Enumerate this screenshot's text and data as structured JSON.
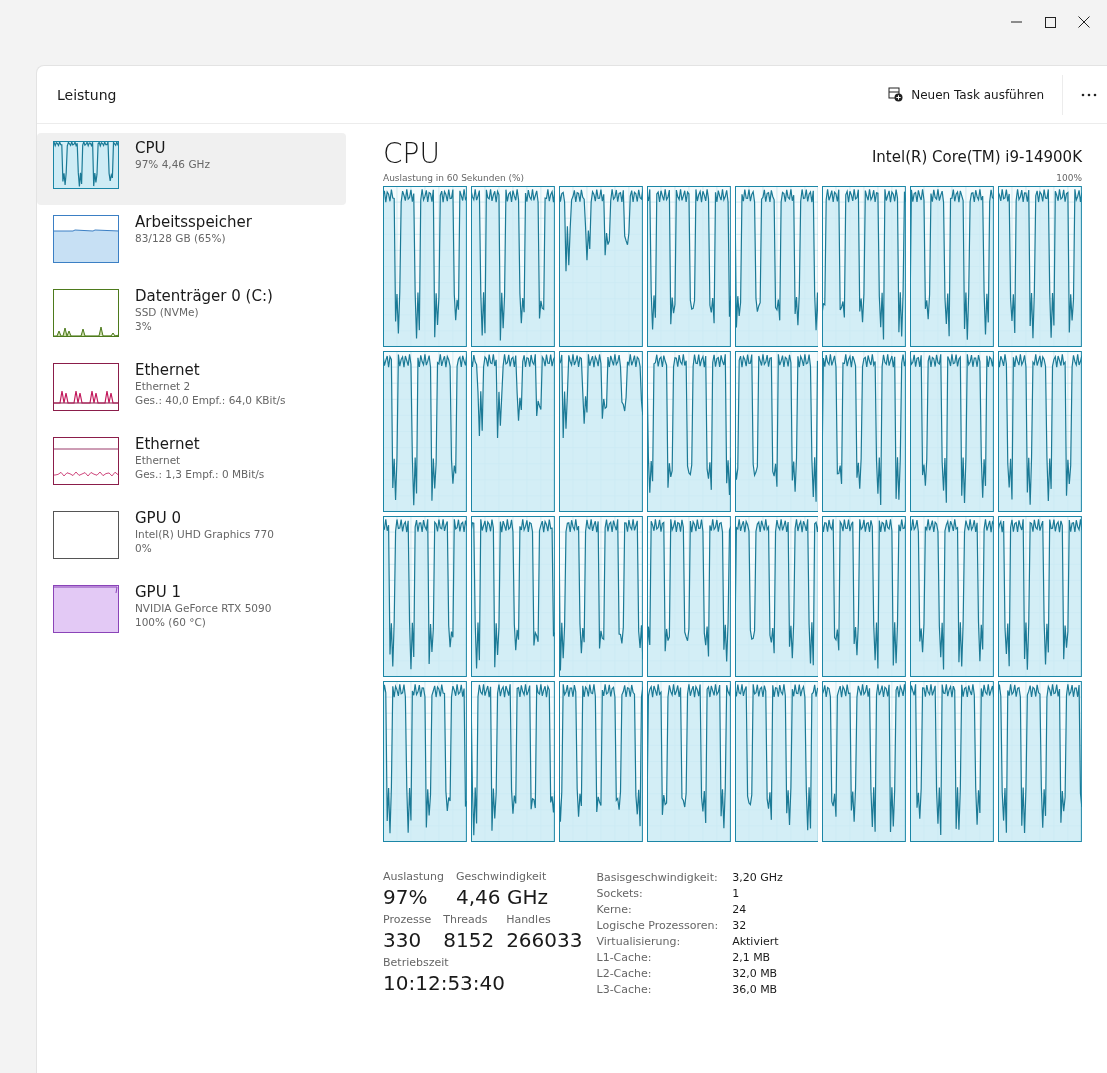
{
  "header": {
    "title": "Leistung",
    "run_task": "Neuen Task ausführen"
  },
  "sidebar": {
    "items": [
      {
        "kind": "cpu",
        "title": "CPU",
        "lines": [
          "97% 4,46 GHz"
        ],
        "selected": true
      },
      {
        "kind": "memory",
        "title": "Arbeitsspeicher",
        "lines": [
          "83/128 GB (65%)"
        ],
        "selected": false
      },
      {
        "kind": "disk",
        "title": "Datenträger 0 (C:)",
        "lines": [
          "SSD (NVMe)",
          "3%"
        ],
        "selected": false
      },
      {
        "kind": "spikes",
        "title": "Ethernet",
        "lines": [
          "Ethernet 2",
          "Ges.: 40,0 Empf.: 64,0 KBit/s"
        ],
        "selected": false
      },
      {
        "kind": "flat",
        "title": "Ethernet",
        "lines": [
          "Ethernet",
          "Ges.: 1,3 Empf.: 0 MBit/s"
        ],
        "selected": false
      },
      {
        "kind": "empty",
        "title": "GPU 0",
        "lines": [
          "Intel(R) UHD Graphics 770",
          "0%"
        ],
        "selected": false
      },
      {
        "kind": "full",
        "title": "GPU 1",
        "lines": [
          "NVIDIA GeForce RTX 5090",
          "100% (60 °C)"
        ],
        "selected": false
      }
    ]
  },
  "main": {
    "title": "CPU",
    "model": "Intel(R) Core(TM) i9-14900K",
    "graph_caption": "Auslastung in 60 Sekunden (%)",
    "graph_max": "100%"
  },
  "stats": {
    "rows": [
      [
        {
          "label": "Auslastung",
          "value": "97%"
        },
        {
          "label": "Geschwindigkeit",
          "value": "4,46 GHz"
        }
      ],
      [
        {
          "label": "Prozesse",
          "value": "330"
        },
        {
          "label": "Threads",
          "value": "8152"
        },
        {
          "label": "Handles",
          "value": "266033"
        }
      ],
      [
        {
          "label": "Betriebszeit",
          "value": "10:12:53:40"
        }
      ]
    ]
  },
  "specs": [
    {
      "label": "Basisgeschwindigkeit:",
      "value": "3,20 GHz"
    },
    {
      "label": "Sockets:",
      "value": "1"
    },
    {
      "label": "Kerne:",
      "value": "24"
    },
    {
      "label": "Logische Prozessoren:",
      "value": "32"
    },
    {
      "label": "Virtualisierung:",
      "value": "Aktiviert"
    },
    {
      "label": "L1-Cache:",
      "value": "2,1 MB"
    },
    {
      "label": "L2-Cache:",
      "value": "32,0 MB"
    },
    {
      "label": "L3-Cache:",
      "value": "36,0 MB"
    }
  ]
}
